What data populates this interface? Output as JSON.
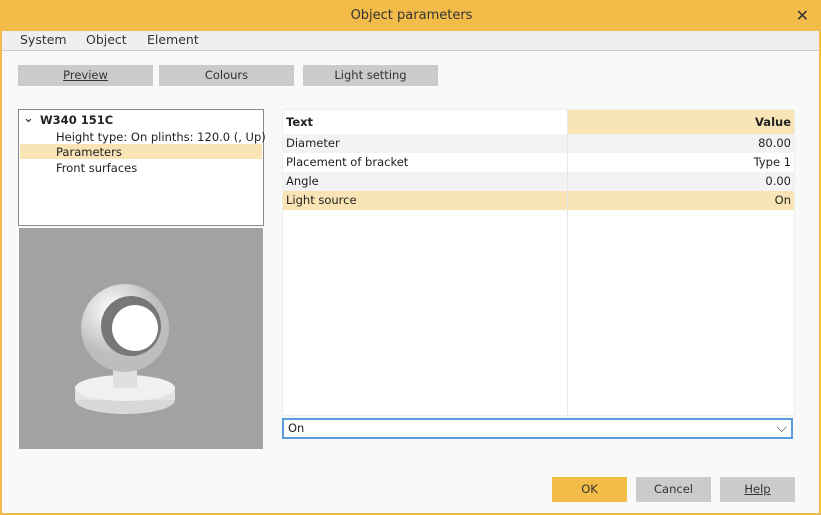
{
  "window": {
    "title": "Object parameters",
    "close_icon": "close-icon"
  },
  "menu": [
    "System",
    "Object",
    "Element"
  ],
  "toolbar": {
    "preview": "Preview",
    "colours": "Colours",
    "light_setting": "Light setting"
  },
  "tree": {
    "root": "W340 151C",
    "children": [
      "Height type: On plinths:  120.0 (, Up)",
      "Parameters",
      "Front surfaces"
    ],
    "selected": "Parameters"
  },
  "grid": {
    "headers": {
      "text": "Text",
      "value": "Value"
    },
    "rows": [
      {
        "text": "Diameter",
        "value": "80.00"
      },
      {
        "text": "Placement of bracket",
        "value": "Type 1"
      },
      {
        "text": "Angle",
        "value": "0.00"
      },
      {
        "text": "Light source",
        "value": "On"
      }
    ],
    "selected": "Light source"
  },
  "combo": {
    "value": "On"
  },
  "buttons": {
    "ok": "OK",
    "cancel": "Cancel",
    "help": "Help"
  },
  "colors": {
    "accent": "#f3bc48",
    "highlight": "#f9e4b5"
  }
}
